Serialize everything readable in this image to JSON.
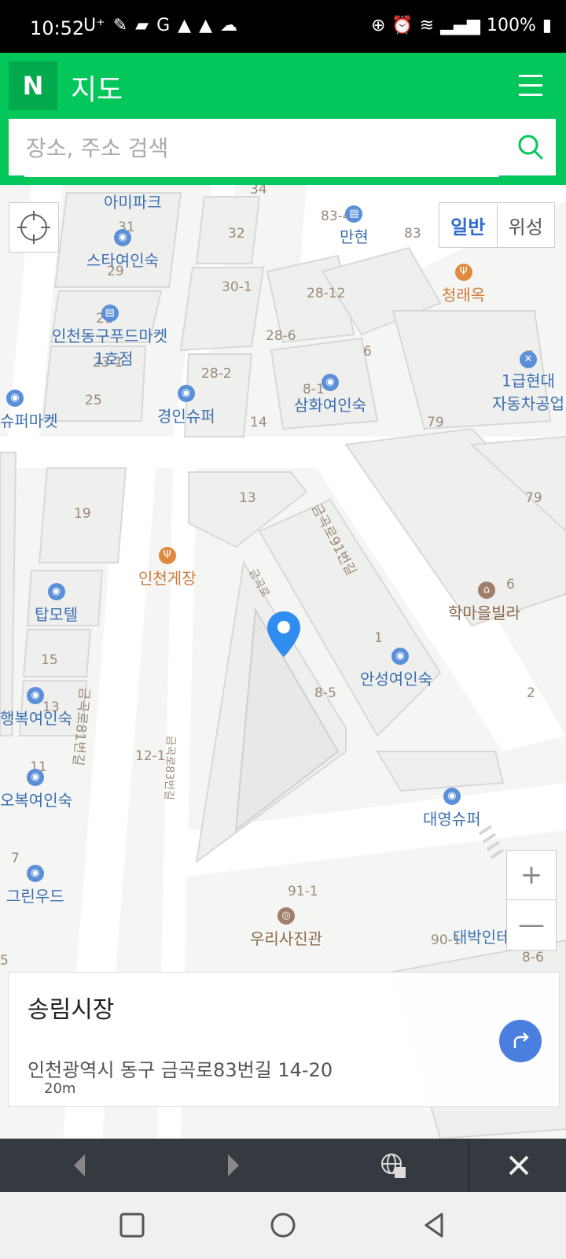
{
  "status": {
    "time": "10:52",
    "carrier": "U⁺",
    "battery": "100%"
  },
  "header": {
    "logo": "N",
    "title": "지도"
  },
  "search": {
    "placeholder": "장소, 주소 검색"
  },
  "map": {
    "type_normal": "일반",
    "type_satellite": "위성",
    "zoom_in": "+",
    "zoom_out": "—",
    "scale": "20m",
    "pois": {
      "amipark": "아미파크",
      "starinn": "스타여인숙",
      "foodmarket": "인천동구푸드마켓",
      "foodmarket2": "1호점",
      "kyunginsuper": "경인슈퍼",
      "samhwa": "삼화여인숙",
      "manhyun": "만현",
      "chungraeok": "청래옥",
      "hyundai1": "1급현대",
      "hyundai2": "자동차공업",
      "supermarket": "슈퍼마켓",
      "incheongejang": "인천게장",
      "tophotel": "탑모텔",
      "haengbok": "행복여인숙",
      "obok": "오복여인숙",
      "greenwood": "그린우드",
      "anseong": "안성여인숙",
      "hakmaeul": "학마을빌라",
      "daeyoung": "대영슈퍼",
      "uri": "우리사진관",
      "daebak": "대박인테리어"
    },
    "roads": {
      "r91": "금곡로91번길",
      "r81": "금곡로81번길",
      "r83": "금곡로83번길",
      "rshort": "금곡로"
    },
    "lots": {
      "l34": "34",
      "l32": "32",
      "l83_4": "83-4",
      "l83": "83",
      "l30_1": "30-1",
      "l28_12": "28-12",
      "l28_6": "28-6",
      "l6": "6",
      "l28_2": "28-2",
      "l8_1": "8-1",
      "l14": "14",
      "l79a": "79",
      "l79b": "79",
      "l7a": "7",
      "l25": "25",
      "l29": "29",
      "l31": "31",
      "l21": "21",
      "l23_1": "23-1",
      "l13": "13",
      "l19": "19",
      "l6b": "6",
      "l1": "1",
      "l8_5": "8-5",
      "l15": "15",
      "l13b": "13",
      "l12_1": "12-1",
      "l11": "11",
      "l2": "2",
      "l7b": "7",
      "l91_1": "91-1",
      "l90_1": "90-1",
      "l8_6": "8-6",
      "l5": "5"
    }
  },
  "place": {
    "name": "송림시장",
    "address": "인천광역시 동구 금곡로83번길 14-20"
  },
  "colors": {
    "brand": "#03C75A",
    "accent_blue": "#2f6ad0"
  }
}
